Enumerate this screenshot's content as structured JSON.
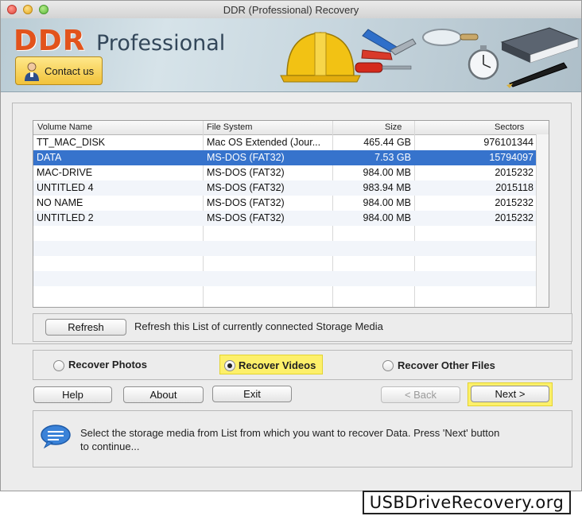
{
  "window": {
    "title": "DDR (Professional) Recovery",
    "traffic_lights": [
      "close-icon",
      "minimize-icon",
      "zoom-icon"
    ]
  },
  "banner": {
    "brand": "DDR",
    "product": "Professional",
    "contact_label": "Contact us",
    "illustration_icons": [
      "hard-hat-icon",
      "pliers-icon",
      "screwdriver-icon",
      "magnifier-icon",
      "stopwatch-icon",
      "book-icon",
      "pen-icon"
    ]
  },
  "table": {
    "columns": [
      "Volume Name",
      "File System",
      "Size",
      "Sectors"
    ],
    "rows": [
      {
        "name": "TT_MAC_DISK",
        "fs": "Mac OS Extended (Jour...",
        "size": "465.44  GB",
        "sectors": "976101344"
      },
      {
        "name": "DATA",
        "fs": "MS-DOS (FAT32)",
        "size": "7.53  GB",
        "sectors": "15794097"
      },
      {
        "name": "MAC-DRIVE",
        "fs": "MS-DOS (FAT32)",
        "size": "984.00  MB",
        "sectors": "2015232"
      },
      {
        "name": "UNTITLED 4",
        "fs": "MS-DOS (FAT32)",
        "size": "983.94  MB",
        "sectors": "2015118"
      },
      {
        "name": "NO NAME",
        "fs": "MS-DOS (FAT32)",
        "size": "984.00  MB",
        "sectors": "2015232"
      },
      {
        "name": "UNTITLED 2",
        "fs": "MS-DOS (FAT32)",
        "size": "984.00  MB",
        "sectors": "2015232"
      }
    ],
    "selected_row": "DATA"
  },
  "refresh": {
    "button_label": "Refresh",
    "description": "Refresh this List of currently connected Storage Media"
  },
  "recover_options": {
    "photos": "Recover Photos",
    "videos": "Recover Videos",
    "other": "Recover Other Files",
    "selected": "Recover Videos"
  },
  "buttons": {
    "help": "Help",
    "about": "About",
    "exit": "Exit",
    "back": "< Back",
    "next": "Next >"
  },
  "info": {
    "line1": "Select the storage media from List from which you want to recover Data. Press 'Next' button",
    "line2": "to continue...",
    "icon": "speech-bubble-icon"
  },
  "footer": {
    "watermark": "USBDriveRecovery.org"
  },
  "colors": {
    "selection": "#3673cc",
    "brand_orange": "#e2531c",
    "highlight_yellow": "#fdf06a"
  }
}
